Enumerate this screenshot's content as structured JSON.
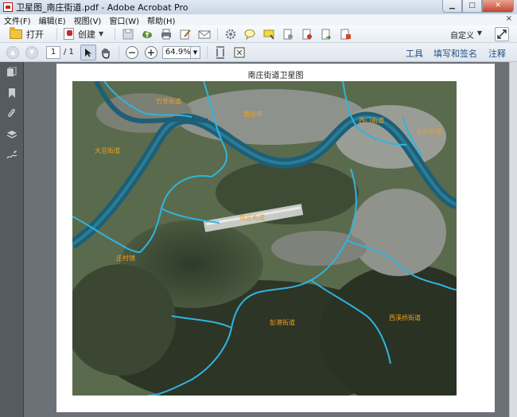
{
  "window": {
    "title": "卫星图_南庄街道.pdf - Adobe Acrobat Pro",
    "controls": {
      "minimize": "▁",
      "maximize": "□",
      "close": "✕"
    }
  },
  "menu": {
    "items": [
      "文件(F)",
      "编辑(E)",
      "视图(V)",
      "窗口(W)",
      "帮助(H)"
    ],
    "close": "×"
  },
  "toolbar": {
    "open_label": "打开",
    "create_label": "创建",
    "customize_label": "自定义",
    "icons": [
      "save-icon",
      "cloud-upload-icon",
      "print-icon",
      "edit-icon",
      "email-icon",
      "gear-icon",
      "comment-icon",
      "highlight-icon",
      "attach-icon",
      "stamp-icon",
      "export-icon",
      "sign-icon"
    ]
  },
  "navbar": {
    "page_current": "1",
    "page_total": "/ 1",
    "zoom_value": "64.9%",
    "zoom_out": "−",
    "zoom_in": "+",
    "right_links": {
      "tools": "工具",
      "fill_sign": "填写和签名",
      "comment": "注释"
    }
  },
  "document": {
    "page_title": "南庄街道卫星图",
    "map_labels": [
      {
        "text": "竹苍街道"
      },
      {
        "text": "南尖市"
      },
      {
        "text": "西门街道"
      },
      {
        "text": "大旦街道"
      },
      {
        "text": "东大街道"
      },
      {
        "text": "南庄街道"
      },
      {
        "text": "庄村镇"
      },
      {
        "text": "彭港街道"
      },
      {
        "text": "西溪桥街道"
      }
    ]
  }
}
